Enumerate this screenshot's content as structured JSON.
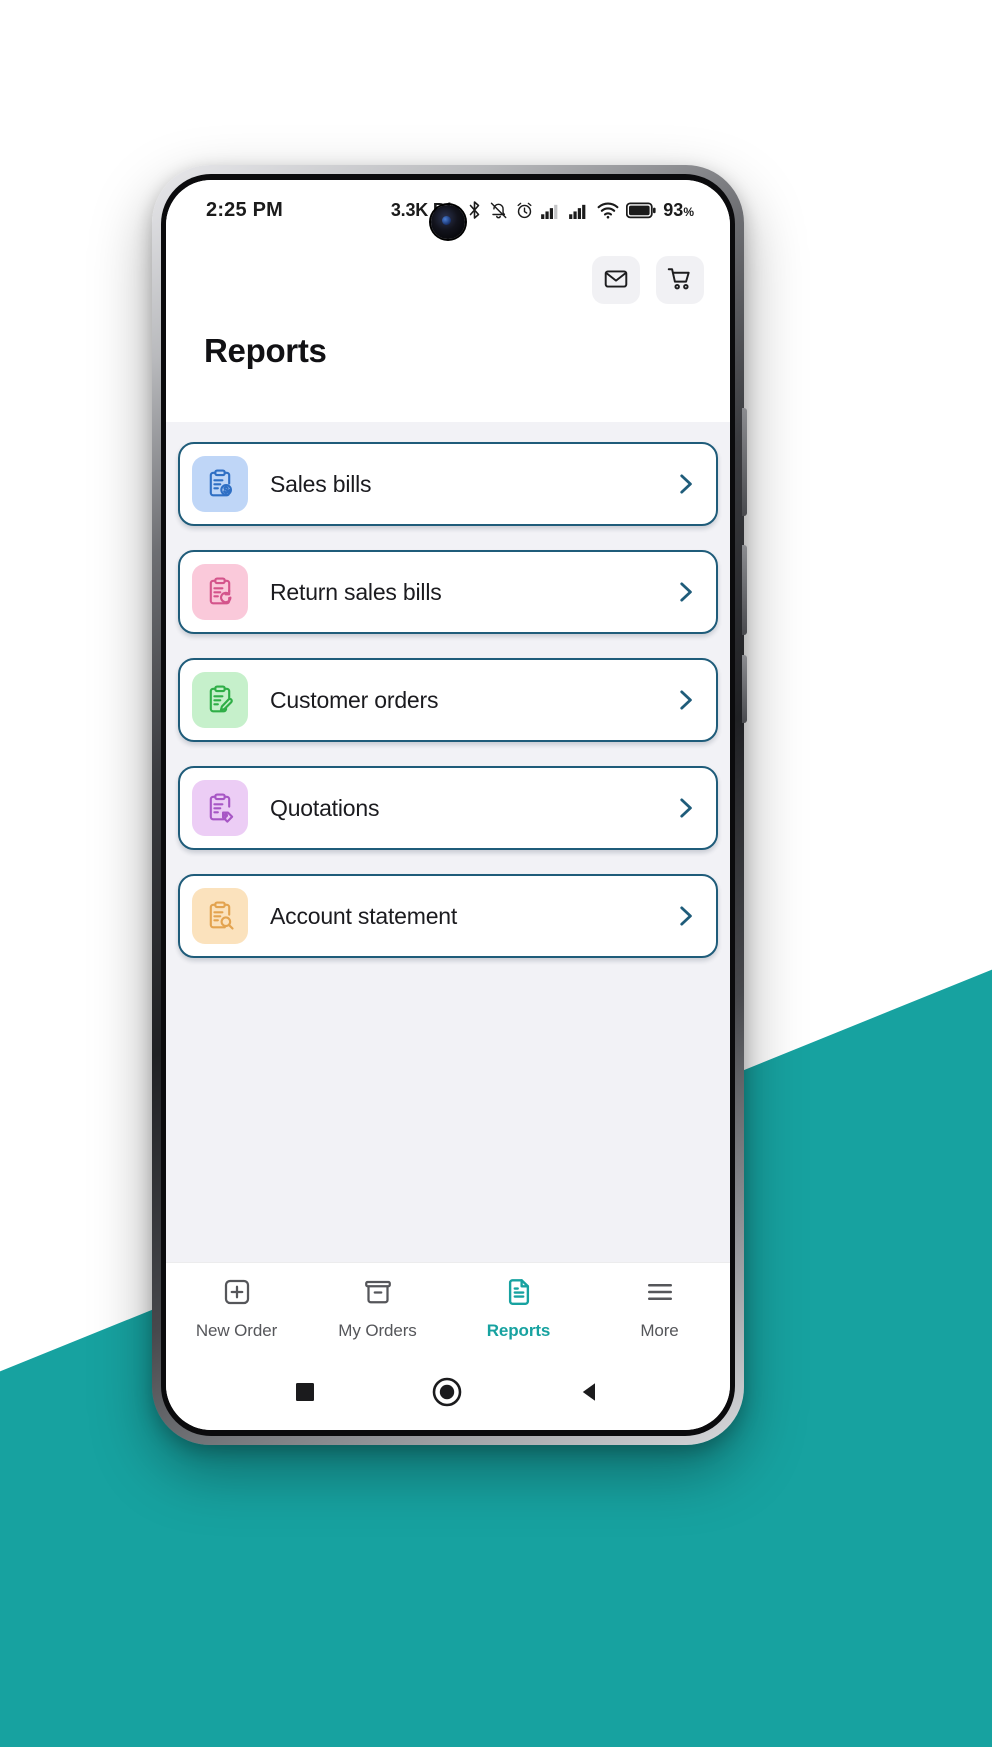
{
  "status_bar": {
    "clock": "2:25 PM",
    "network_speed": "3.3K B/s",
    "battery_percent": "93",
    "battery_percent_symbol": "%",
    "icons": [
      "bluetooth-icon",
      "mute-icon",
      "alarm-icon",
      "signal-bars-icon",
      "signal-bars-icon",
      "wifi-icon",
      "battery-icon"
    ]
  },
  "header": {
    "title": "Reports",
    "mail_button_name": "mail-icon",
    "cart_button_name": "cart-icon"
  },
  "reports": [
    {
      "label": "Sales bills",
      "icon": "clipboard-dollar-icon",
      "tile_bg": "#bfd6f7",
      "icon_color": "#2f6fc4"
    },
    {
      "label": "Return sales bills",
      "icon": "clipboard-return-icon",
      "tile_bg": "#fac9da",
      "icon_color": "#d4548b"
    },
    {
      "label": "Customer orders",
      "icon": "clipboard-pencil-icon",
      "tile_bg": "#c6f0cb",
      "icon_color": "#2fae47"
    },
    {
      "label": "Quotations",
      "icon": "clipboard-tag-icon",
      "tile_bg": "#eccdf5",
      "icon_color": "#a756c5"
    },
    {
      "label": "Account statement",
      "icon": "clipboard-search-icon",
      "tile_bg": "#fbe2bd",
      "icon_color": "#e3a34f"
    }
  ],
  "tabs": [
    {
      "label": "New Order",
      "icon": "plus-square-icon",
      "active": false
    },
    {
      "label": "My Orders",
      "icon": "archive-box-icon",
      "active": false
    },
    {
      "label": "Reports",
      "icon": "document-icon",
      "active": true
    },
    {
      "label": "More",
      "icon": "hamburger-icon",
      "active": false
    }
  ],
  "nav_bar": {
    "recents": "square-icon",
    "home": "circle-icon",
    "back": "triangle-back-icon"
  },
  "colors": {
    "accent_teal": "#17a2a0",
    "card_border": "#1f5c7a",
    "content_bg": "#f2f2f6",
    "backdrop_teal": "#17a2a0"
  }
}
